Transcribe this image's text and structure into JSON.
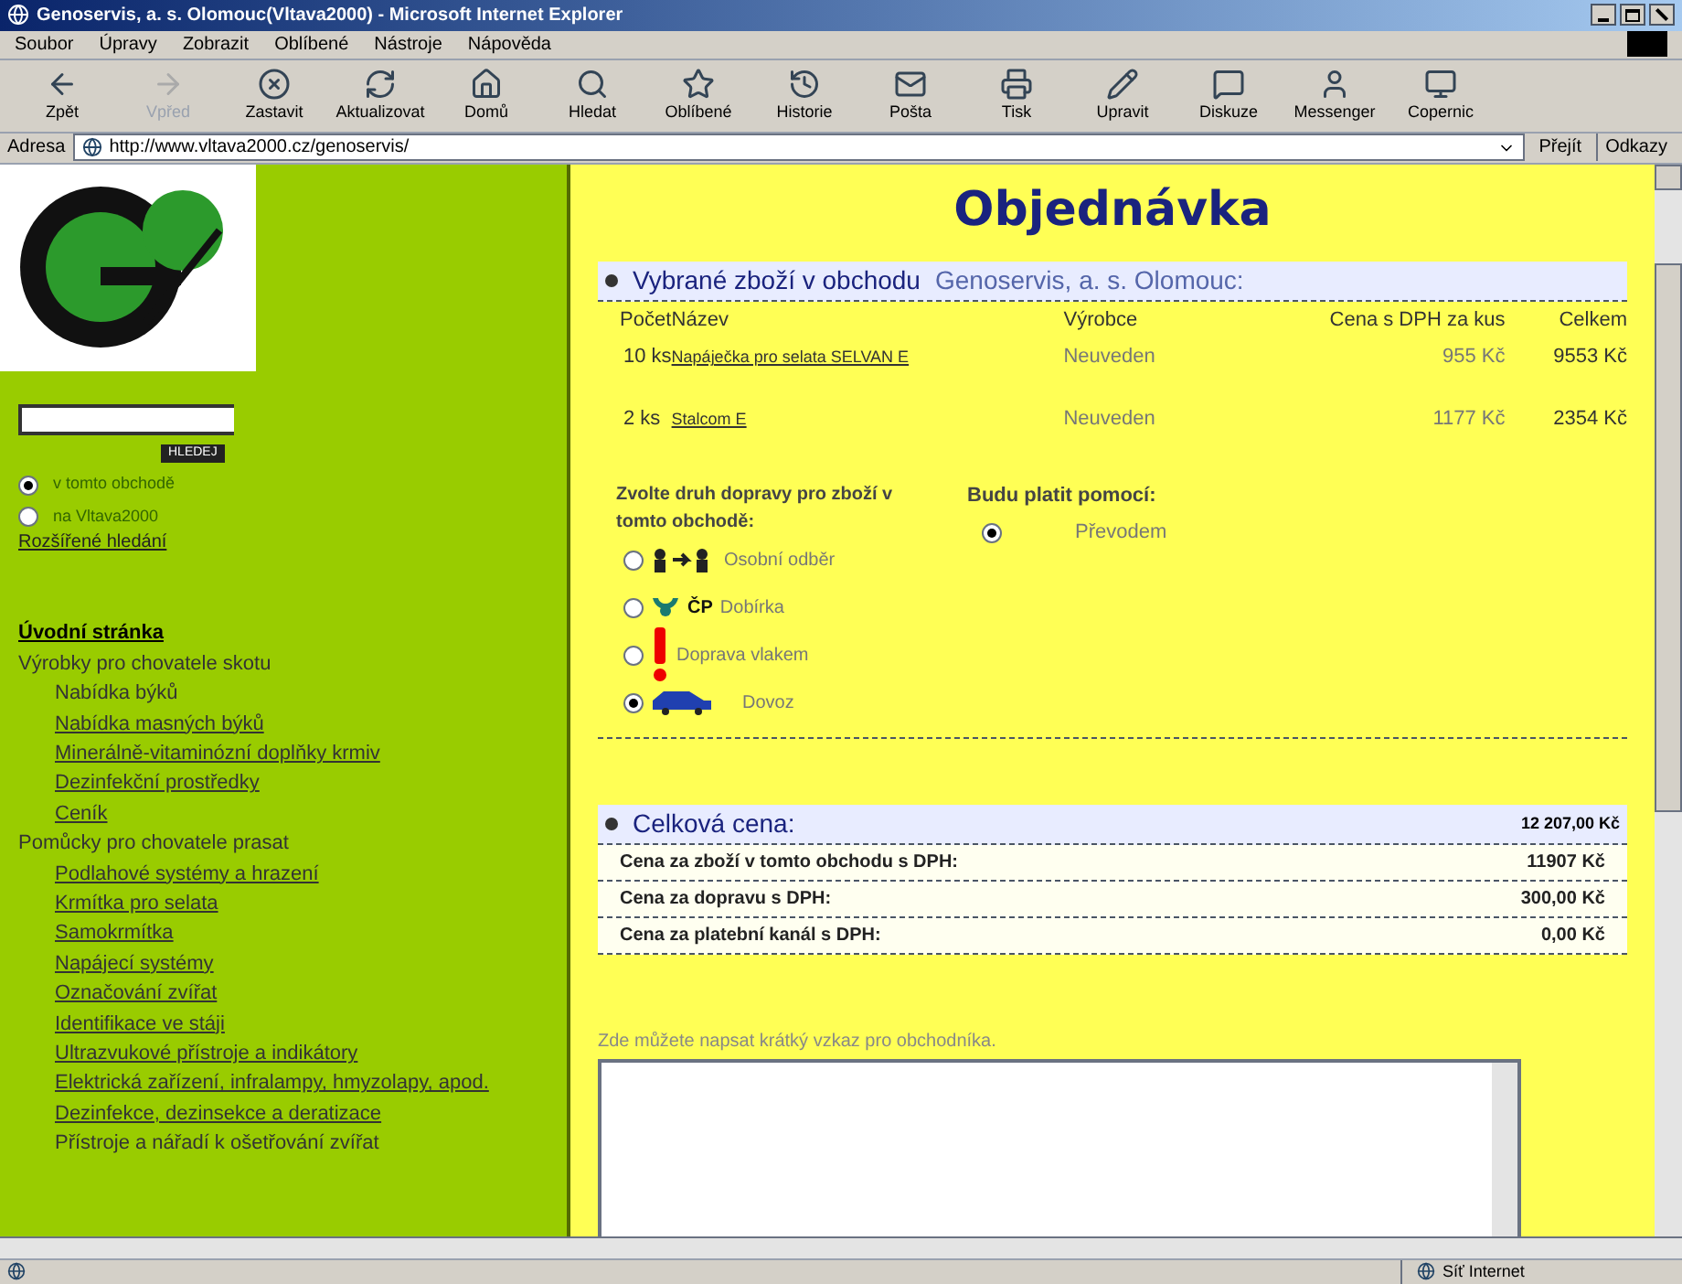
{
  "window": {
    "title": "Genoservis, a. s. Olomouc(Vltava2000) - Microsoft Internet Explorer"
  },
  "menu": [
    "Soubor",
    "Úpravy",
    "Zobrazit",
    "Oblíbené",
    "Nástroje",
    "Nápověda"
  ],
  "toolbar": [
    {
      "label": "Zpět",
      "disabled": false
    },
    {
      "label": "Vpřed",
      "disabled": true
    },
    {
      "label": "Zastavit",
      "disabled": false
    },
    {
      "label": "Aktualizovat",
      "disabled": false
    },
    {
      "label": "Domů",
      "disabled": false
    },
    {
      "label": "Hledat",
      "disabled": false
    },
    {
      "label": "Oblíbené",
      "disabled": false
    },
    {
      "label": "Historie",
      "disabled": false
    },
    {
      "label": "Pošta",
      "disabled": false
    },
    {
      "label": "Tisk",
      "disabled": false
    },
    {
      "label": "Upravit",
      "disabled": false
    },
    {
      "label": "Diskuze",
      "disabled": false
    },
    {
      "label": "Messenger",
      "disabled": false
    },
    {
      "label": "Copernic",
      "disabled": false
    }
  ],
  "address": {
    "label": "Adresa",
    "url": "http://www.vltava2000.cz/genoservis/",
    "go": "Přejít",
    "links": "Odkazy"
  },
  "sidebar": {
    "search_button": "HLEDEJ",
    "scope": [
      {
        "label": "v tomto obchodě",
        "selected": true
      },
      {
        "label": "na Vltava2000",
        "selected": false
      }
    ],
    "advanced": "Rozšířené hledání",
    "nav": [
      {
        "label": "Úvodní stránka",
        "kind": "home"
      },
      {
        "label": "Výrobky pro chovatele skotu",
        "kind": "group",
        "children": [
          {
            "label": "Nabídka býků",
            "kind": "plain"
          },
          {
            "label": "Nabídka masných býků",
            "kind": "link"
          },
          {
            "label": "Minerálně-vitaminózní doplňky krmiv",
            "kind": "link"
          },
          {
            "label": "Dezinfekční prostředky",
            "kind": "link"
          },
          {
            "label": "Ceník",
            "kind": "link"
          }
        ]
      },
      {
        "label": "Pomůcky pro chovatele prasat",
        "kind": "group",
        "children": [
          {
            "label": "Podlahové systémy a hrazení",
            "kind": "link"
          },
          {
            "label": "Krmítka pro selata",
            "kind": "link"
          },
          {
            "label": "Samokrmítka",
            "kind": "link"
          },
          {
            "label": "Napájecí systémy",
            "kind": "link"
          },
          {
            "label": "Označování zvířat",
            "kind": "link"
          },
          {
            "label": "Identifikace ve stáji",
            "kind": "link"
          },
          {
            "label": "Ultrazvukové přístroje a indikátory",
            "kind": "link"
          },
          {
            "label": "Elektrická zařízení, infralampy, hmyzolapy, apod.",
            "kind": "link"
          },
          {
            "label": "Dezinfekce, dezinsekce a deratizace",
            "kind": "link"
          },
          {
            "label": "Přístroje a nářadí k ošetřování zvířat",
            "kind": "plain"
          }
        ]
      }
    ]
  },
  "page": {
    "title": "Objednávka",
    "section": {
      "label": "Vybrané zboží v obchodu",
      "shop": "Genoservis, a. s. Olomouc:"
    },
    "table": {
      "columns": [
        "Počet",
        "Název",
        "Výrobce",
        "Cena s DPH za kus",
        "Celkem"
      ],
      "rows": [
        [
          "10 ks",
          "Napáječka pro selata SELVAN E",
          "Neuveden",
          "955 Kč",
          "9553 Kč"
        ],
        [
          "2 ks",
          "Stalcom E",
          "Neuveden",
          "1177 Kč",
          "2354 Kč"
        ]
      ]
    },
    "shipping": {
      "label": "Zvolte druh dopravy pro zboží v tomto obchodě:",
      "options": [
        {
          "label": "Osobní odběr",
          "kind": "pickup",
          "selected": false
        },
        {
          "label": "Dobírka",
          "kind": "post",
          "logo_text": "ČP",
          "selected": false
        },
        {
          "label": "Doprava vlakem",
          "kind": "train",
          "selected": false
        },
        {
          "label": "Dovoz",
          "kind": "car",
          "selected": true
        }
      ]
    },
    "payment": {
      "label": "Budu platit pomocí:",
      "options": [
        {
          "label": "Převodem",
          "selected": true
        }
      ]
    },
    "totals": {
      "label": "Celková cena:",
      "value": "12 207,00 Kč",
      "rows": [
        {
          "label": "Cena za zboží v tomto obchodu s DPH:",
          "value": "11907 Kč"
        },
        {
          "label": "Cena za dopravu s DPH:",
          "value": "300,00 Kč"
        },
        {
          "label": "Cena za platební kanál s DPH:",
          "value": "0,00 Kč"
        }
      ]
    },
    "note": {
      "label": "Zde můžete napsat krátký vzkaz pro obchodníka."
    }
  },
  "status_bar": {
    "zone": "Síť Internet"
  }
}
